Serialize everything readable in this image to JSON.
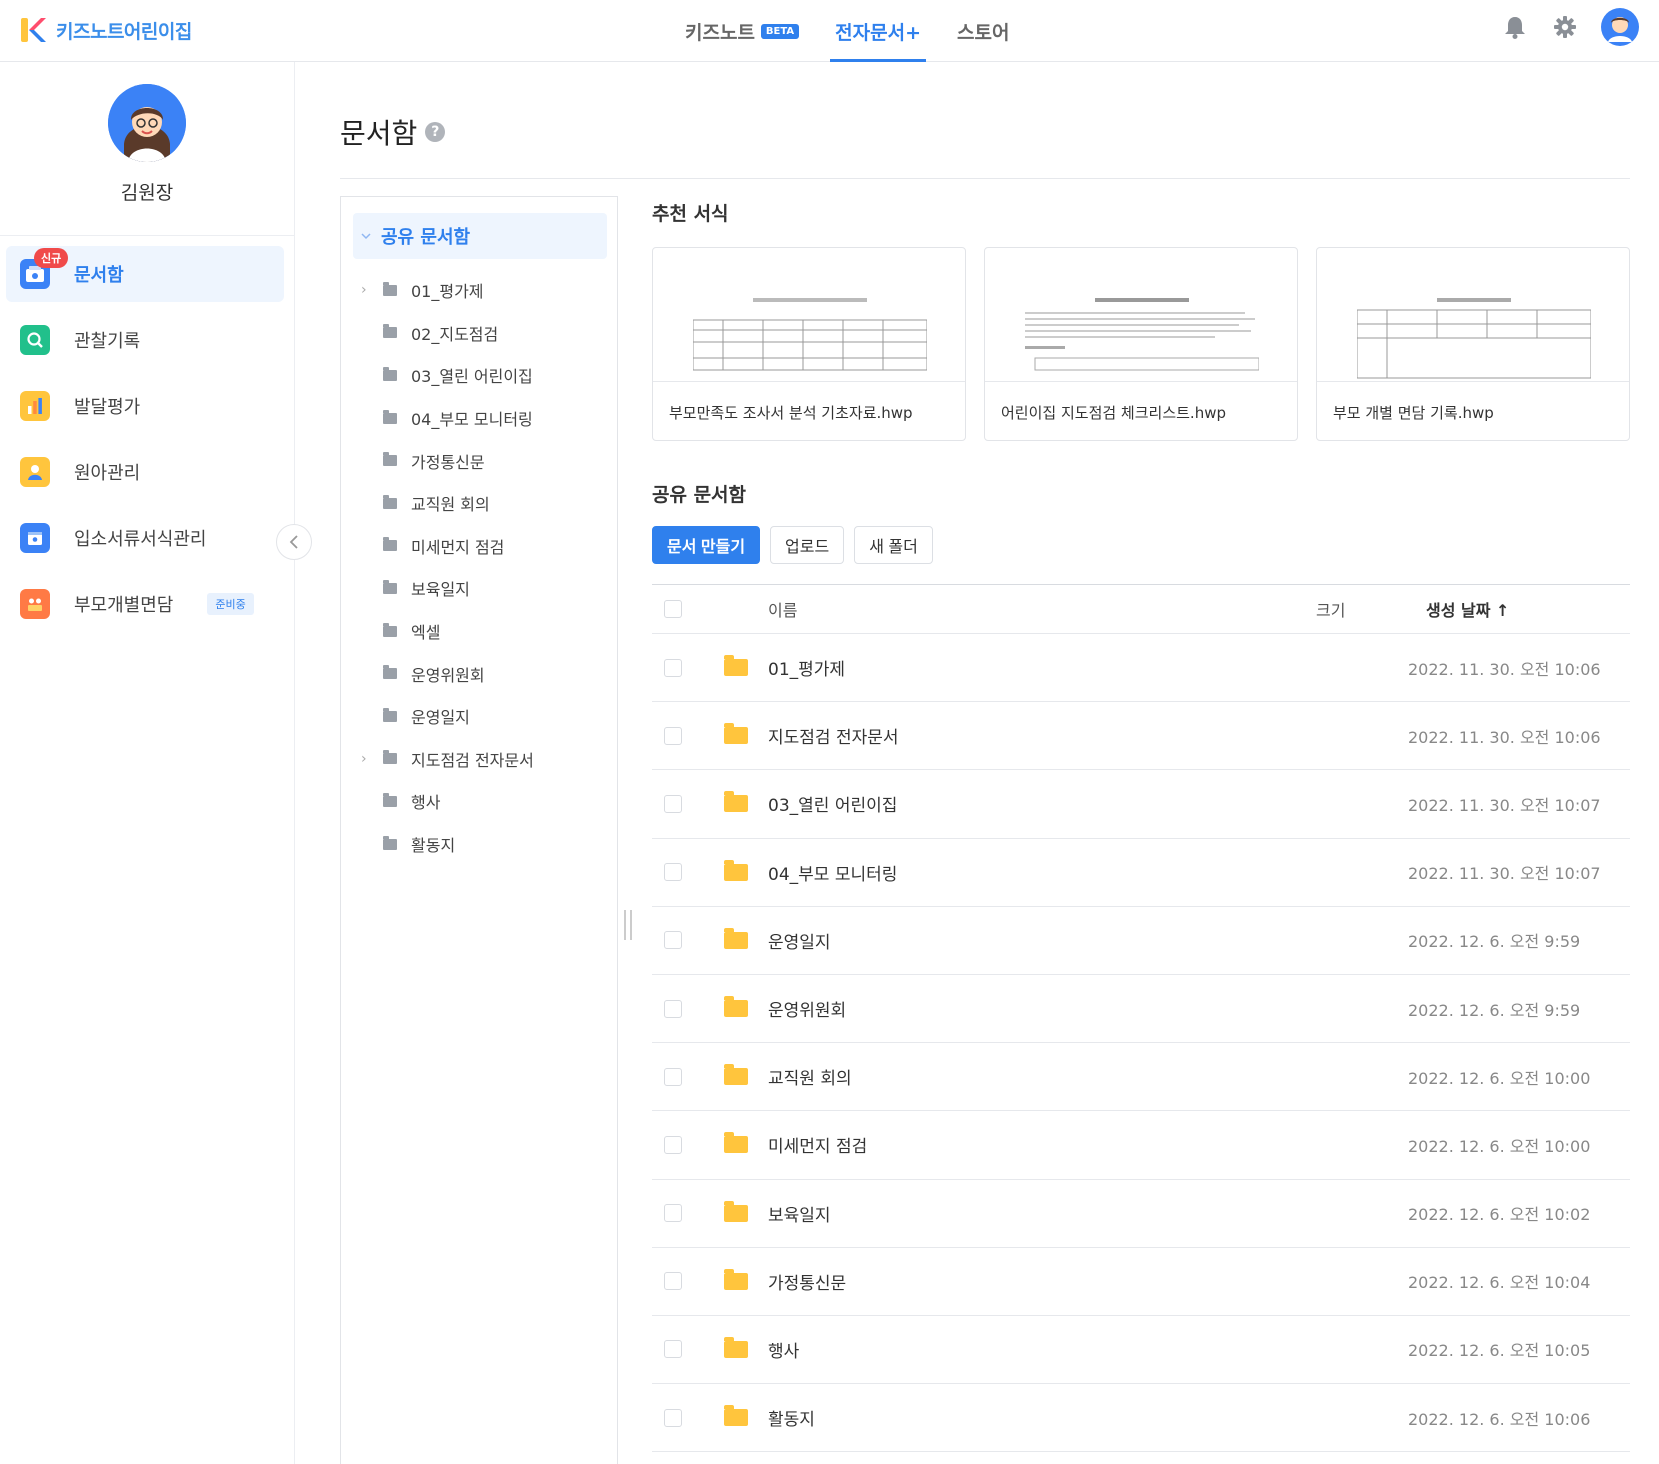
{
  "header": {
    "brand_name": "키즈노트어린이집",
    "nav": [
      {
        "label": "키즈노트",
        "badge": "BETA"
      },
      {
        "label": "전자문서+"
      },
      {
        "label": "스토어"
      }
    ],
    "icons": [
      "bell-icon",
      "gear-icon",
      "user-avatar"
    ]
  },
  "sidebar": {
    "user_name": "김원장",
    "items": [
      {
        "label": "문서함",
        "badge": "신규",
        "icon": "document-box-icon",
        "color": "#3b82f6",
        "active": true
      },
      {
        "label": "관찰기록",
        "icon": "magnifier-icon",
        "color": "#21c08b"
      },
      {
        "label": "발달평가",
        "icon": "bar-chart-icon",
        "color": "#ffc53d"
      },
      {
        "label": "원아관리",
        "icon": "child-icon",
        "color": "#ffc53d"
      },
      {
        "label": "입소서류서식관리",
        "icon": "form-icon",
        "color": "#3b82f6"
      },
      {
        "label": "부모개별면담",
        "icon": "meeting-icon",
        "color": "#ff7a45",
        "tag": "준비중"
      }
    ]
  },
  "page": {
    "title": "문서함",
    "help": "?"
  },
  "tree": {
    "root": "공유 문서함",
    "items": [
      {
        "label": "01_평가제",
        "expandable": true
      },
      {
        "label": "02_지도점검"
      },
      {
        "label": "03_열린 어린이집"
      },
      {
        "label": "04_부모 모니터링"
      },
      {
        "label": "가정통신문"
      },
      {
        "label": "교직원 회의"
      },
      {
        "label": "미세먼지 점검"
      },
      {
        "label": "보육일지"
      },
      {
        "label": "엑셀"
      },
      {
        "label": "운영위원회"
      },
      {
        "label": "운영일지"
      },
      {
        "label": "지도점검 전자문서",
        "expandable": true
      },
      {
        "label": "행사"
      },
      {
        "label": "활동지"
      }
    ]
  },
  "recommended": {
    "title": "추천 서식",
    "templates": [
      {
        "name": "부모만족도 조사서 분석 기초자료.hwp"
      },
      {
        "name": "어린이집 지도점검 체크리스트.hwp"
      },
      {
        "name": "부모 개별 면담 기록.hwp"
      }
    ]
  },
  "shared": {
    "title": "공유 문서함",
    "buttons": {
      "create": "문서 만들기",
      "upload": "업로드",
      "new_folder": "새 폴더"
    },
    "columns": {
      "name": "이름",
      "size": "크기",
      "date": "생성 날짜",
      "sort_arrow": "↑"
    },
    "rows": [
      {
        "name": "01_평가제",
        "date": "2022. 11. 30. 오전 10:06"
      },
      {
        "name": "지도점검 전자문서",
        "date": "2022. 11. 30. 오전 10:06"
      },
      {
        "name": "03_열린 어린이집",
        "date": "2022. 11. 30. 오전 10:07"
      },
      {
        "name": "04_부모 모니터링",
        "date": "2022. 11. 30. 오전 10:07"
      },
      {
        "name": "운영일지",
        "date": "2022. 12. 6. 오전 9:59"
      },
      {
        "name": "운영위원회",
        "date": "2022. 12. 6. 오전 9:59"
      },
      {
        "name": "교직원 회의",
        "date": "2022. 12. 6. 오전 10:00"
      },
      {
        "name": "미세먼지 점검",
        "date": "2022. 12. 6. 오전 10:00"
      },
      {
        "name": "보육일지",
        "date": "2022. 12. 6. 오전 10:02"
      },
      {
        "name": "가정통신문",
        "date": "2022. 12. 6. 오전 10:04"
      },
      {
        "name": "행사",
        "date": "2022. 12. 6. 오전 10:05"
      },
      {
        "name": "활동지",
        "date": "2022. 12. 6. 오전 10:06"
      }
    ]
  },
  "colors": {
    "accent": "#2f80ed",
    "folder": "#ffc53d",
    "new_badge": "#f04a4a"
  }
}
